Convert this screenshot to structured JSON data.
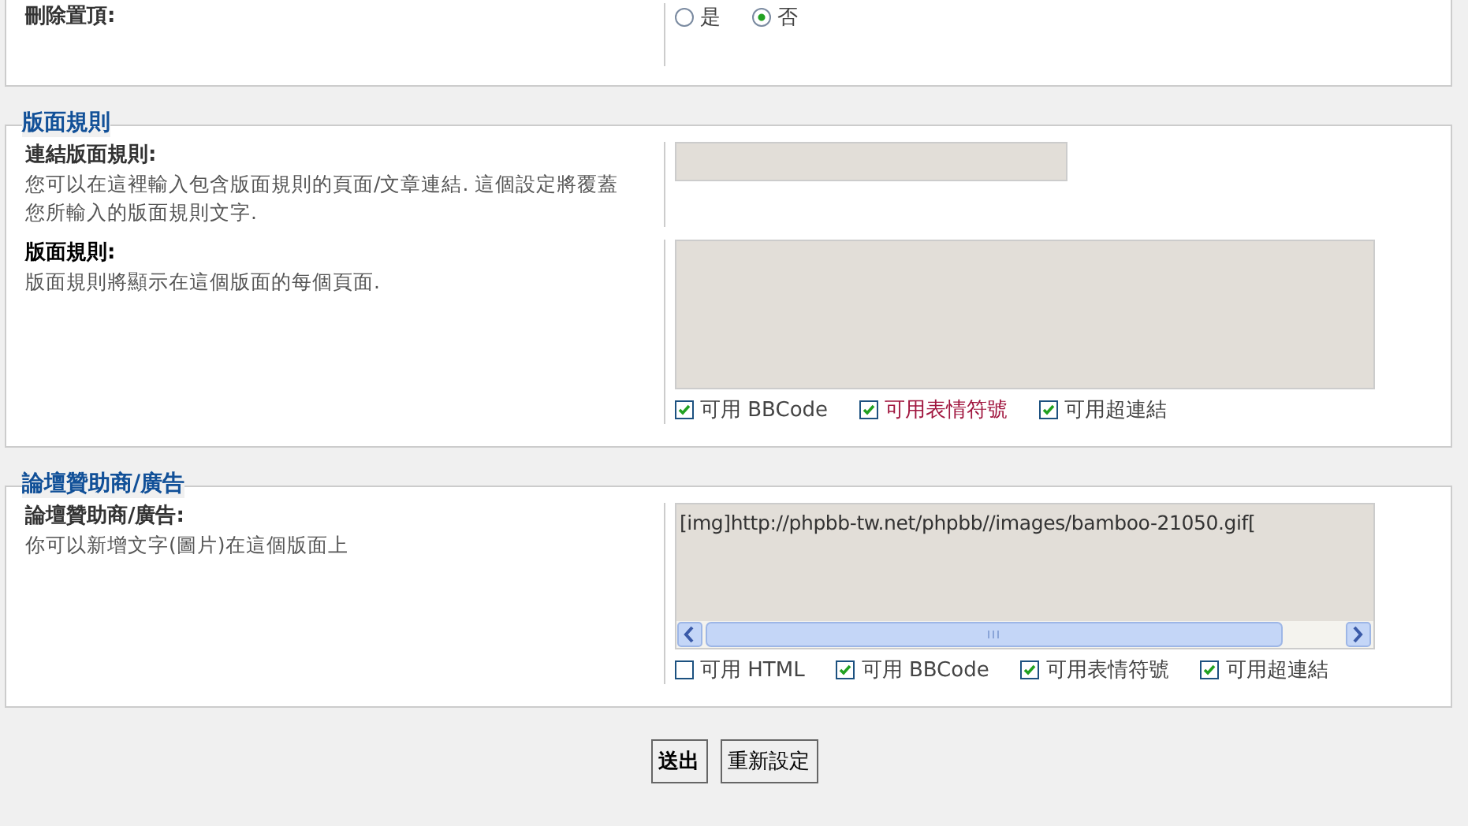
{
  "top_row": {
    "label": "刪除置頂:",
    "options": [
      {
        "label": "是",
        "selected": false
      },
      {
        "label": "否",
        "selected": true
      }
    ]
  },
  "sections": [
    {
      "legend": "版面規則",
      "rows": [
        {
          "title": "連結版面規則:",
          "description": "您可以在這裡輸入包含版面規則的頁面/文章連結. 這個設定將覆蓋您所輸入的版面規則文字.",
          "kind": "input",
          "value": ""
        },
        {
          "title": "版面規則:",
          "description": "版面規則將顯示在這個版面的每個頁面.",
          "kind": "textarea",
          "value": "",
          "options": [
            {
              "label": "可用 BBCode",
              "checked": true,
              "highlighted": false
            },
            {
              "label": "可用表情符號",
              "checked": true,
              "highlighted": true
            },
            {
              "label": "可用超連結",
              "checked": true,
              "highlighted": false
            }
          ]
        }
      ]
    },
    {
      "legend": "論壇贊助商/廣告",
      "rows": [
        {
          "title": "論壇贊助商/廣告:",
          "description": "你可以新增文字(圖片)在這個版面上",
          "kind": "textarea_scroll",
          "value": "[img]http://phpbb-tw.net/phpbb//images/bamboo-21050.gif[",
          "options": [
            {
              "label": "可用 HTML",
              "checked": false,
              "highlighted": false
            },
            {
              "label": "可用 BBCode",
              "checked": true,
              "highlighted": false
            },
            {
              "label": "可用表情符號",
              "checked": true,
              "highlighted": false
            },
            {
              "label": "可用超連結",
              "checked": true,
              "highlighted": false
            }
          ]
        }
      ]
    }
  ],
  "buttons": [
    {
      "label": "送出",
      "kind": "primary"
    },
    {
      "label": "重新設定",
      "kind": "secondary"
    }
  ]
}
